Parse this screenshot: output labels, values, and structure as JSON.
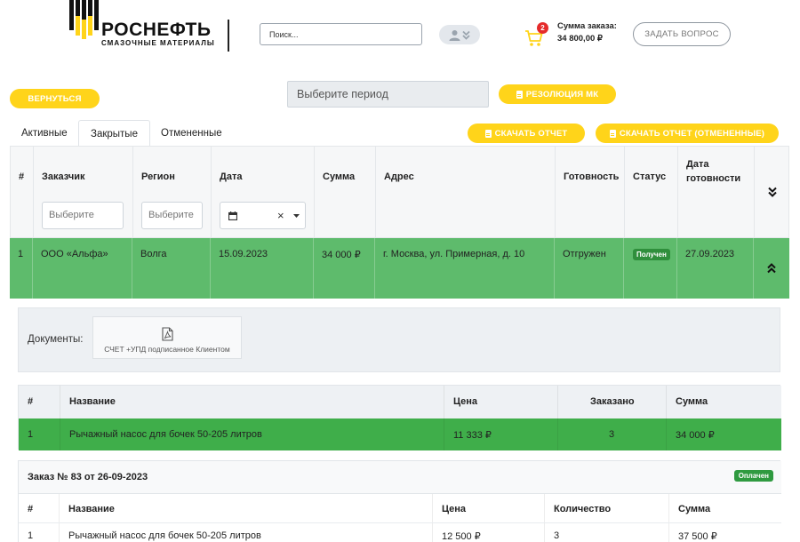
{
  "brand": {
    "name": "РОСНЕФТЬ",
    "subtitle": "СМАЗОЧНЫЕ МАТЕРИАЛЫ",
    "accent": "#ffd41a"
  },
  "header": {
    "search_placeholder": "Поиск...",
    "cart_count": "2",
    "order_sum_label": "Сумма заказа:",
    "order_sum_value": "34 800,00 ₽",
    "ask_label": "ЗАДАТЬ ВОПРОС",
    "user_icon": "user-icon"
  },
  "toolbar": {
    "back_label": "ВЕРНУТЬСЯ",
    "period_placeholder": "Выберите период",
    "resolution_label": "РЕЗОЛЮЦИЯ МК",
    "download_label": "СКАЧАТЬ ОТЧЕТ",
    "download_cancelled_label": "СКАЧАТЬ ОТЧЕТ (ОТМЕНЕННЫЕ)"
  },
  "tabs": [
    {
      "label": "Активные",
      "active": false
    },
    {
      "label": "Закрытые",
      "active": true
    },
    {
      "label": "Отмененные",
      "active": false
    }
  ],
  "table": {
    "columns": [
      "#",
      "Заказчик",
      "Регион",
      "Дата",
      "Сумма",
      "Адрес",
      "Готовность",
      "Статус",
      "Дата готовности"
    ],
    "ready_date_line1": "Дата",
    "ready_date_line2": "готовности",
    "filter_customer_placeholder": "Выберите",
    "filter_region_placeholder": "Выберите",
    "date_clear": "×",
    "rows": [
      {
        "num": "1",
        "customer": "ООО «Альфа»",
        "region": "Волга",
        "date": "15.09.2023",
        "sum": "34 000 ₽",
        "address": "г. Москва, ул. Примерная, д. 10",
        "readiness": "Отгружен",
        "status": "Получен",
        "ready_date": "27.09.2023"
      }
    ],
    "row_color": "#5ebb6c"
  },
  "documents": {
    "label": "Документы:",
    "file_label": "СЧЕТ +УПД подписанное Клиентом"
  },
  "items": {
    "columns": [
      "#",
      "Название",
      "Цена",
      "Заказано",
      "Сумма"
    ],
    "rows": [
      {
        "num": "1",
        "name": "Рычажный насос для бочек 50-205 литров",
        "price": "11 333 ₽",
        "qty": "3",
        "sum": "34 000 ₽"
      }
    ],
    "row_color": "#3fae4a"
  },
  "order2": {
    "title": "Заказ № 83 от 26-09-2023",
    "status": "Оплачен",
    "columns": [
      "#",
      "Название",
      "Цена",
      "Количество",
      "Сумма"
    ],
    "rows": [
      {
        "num": "1",
        "name": "Рычажный насос для бочек 50-205 литров",
        "price": "12 500 ₽",
        "qty": "3",
        "sum": "37 500 ₽"
      }
    ]
  }
}
